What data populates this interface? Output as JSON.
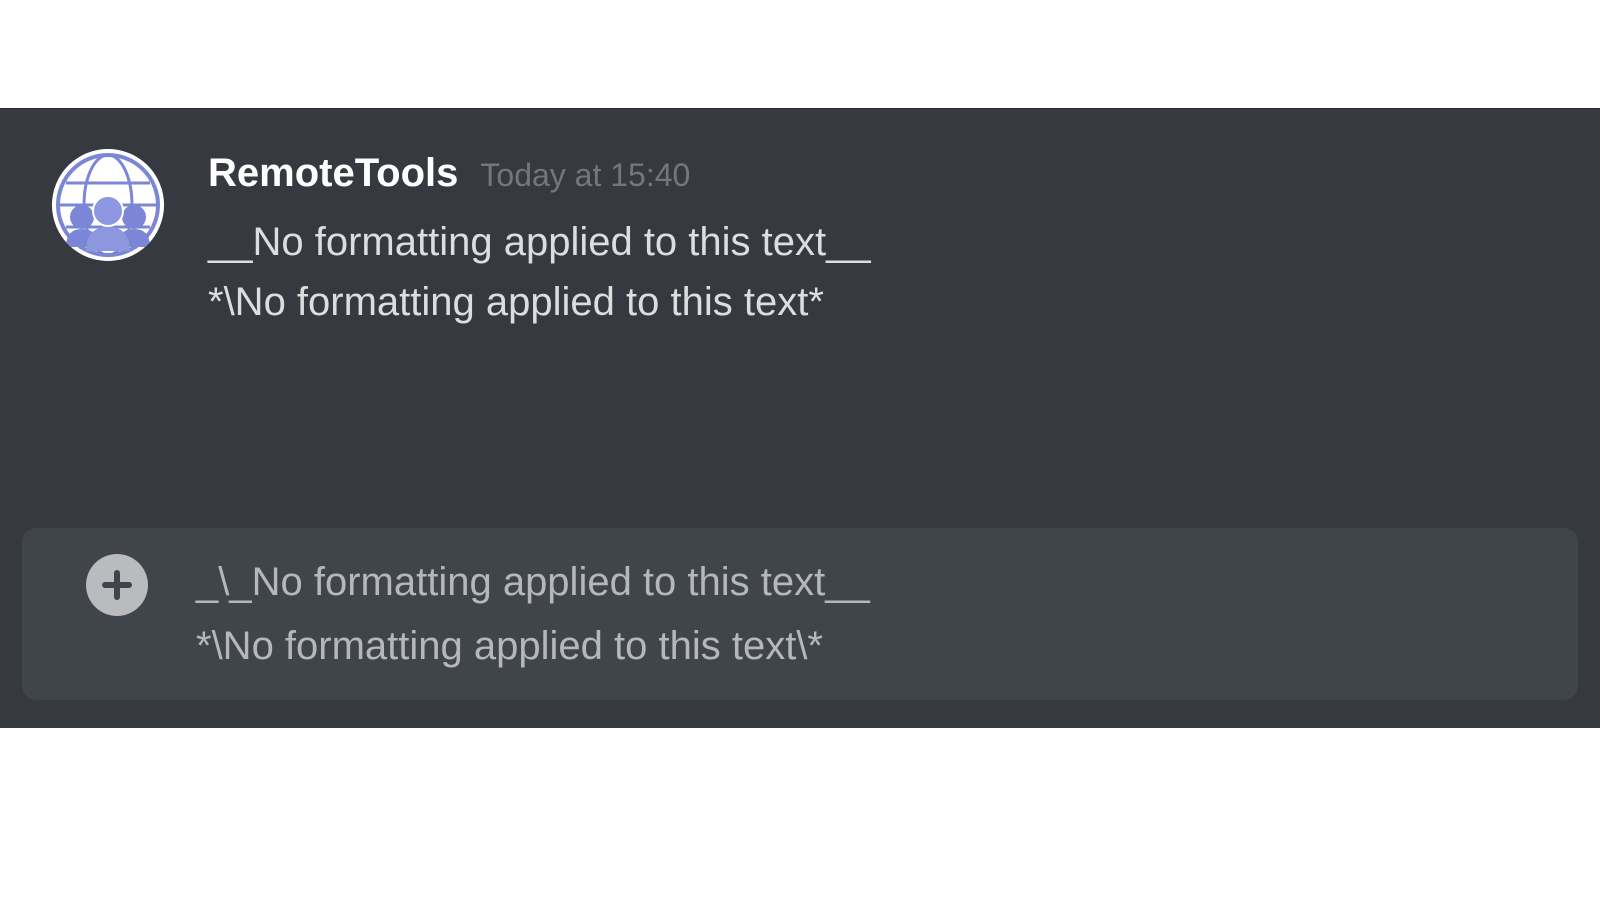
{
  "message": {
    "username": "RemoteTools",
    "timestamp": "Today at 15:40",
    "lines": [
      "__No formatting applied to this text__",
      "*\\No formatting applied to this text*"
    ]
  },
  "input": {
    "lines": [
      "_\\_No formatting applied to this text__",
      "*\\No formatting applied to this text\\*"
    ]
  },
  "colors": {
    "bg": "#36393f",
    "input_bg": "#40444b",
    "text": "#dcddde",
    "muted": "#72767d",
    "username": "#ffffff",
    "avatar_accent": "#7b86d6"
  }
}
